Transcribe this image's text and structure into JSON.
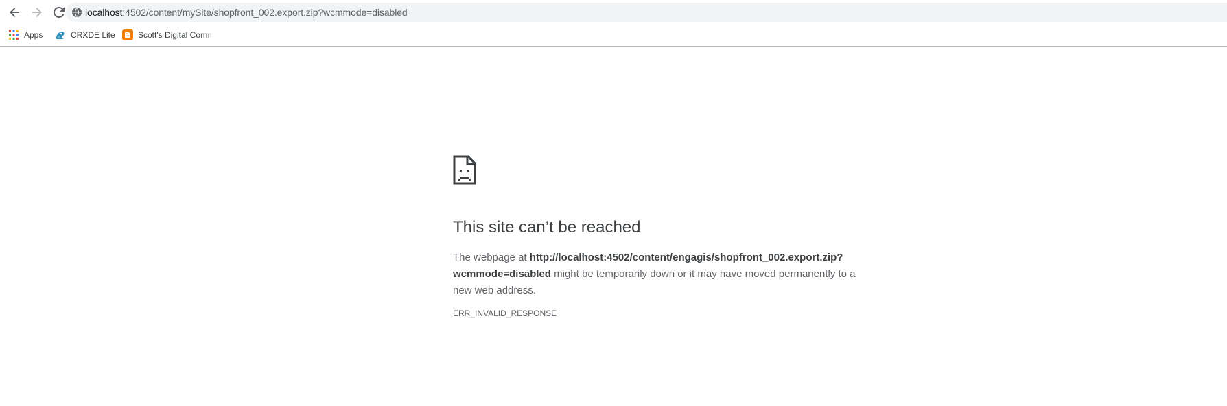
{
  "toolbar": {
    "back_icon": "arrow-left-icon",
    "forward_icon": "arrow-right-icon",
    "reload_icon": "reload-icon",
    "site_info_icon": "globe-icon",
    "url_host": "localhost",
    "url_rest": ":4502/content/mySite/shopfront_002.export.zip?wcmmode=disabled"
  },
  "bookmarks": [
    {
      "label": "Apps",
      "icon": "apps-grid-icon"
    },
    {
      "label": "CRXDE Lite",
      "icon": "crxde-icon"
    },
    {
      "label": "Scott's Digital Comm",
      "icon": "blogger-icon"
    }
  ],
  "error": {
    "icon": "sad-document-icon",
    "title": "This site can’t be reached",
    "desc_prefix": "The webpage at ",
    "desc_url": "http://localhost:4502/content/engagis/shopfront_002.export.zip?wcmmode=disabled",
    "desc_suffix": " might be temporarily down or it may have moved permanently to a new web address.",
    "code": "ERR_INVALID_RESPONSE"
  },
  "colors": {
    "toolbar_bg": "#ffffff",
    "omnibox_bg": "#f1f3f4",
    "text_primary": "#3c4043",
    "text_secondary": "#5f6368",
    "blogger_orange": "#f57d00"
  }
}
